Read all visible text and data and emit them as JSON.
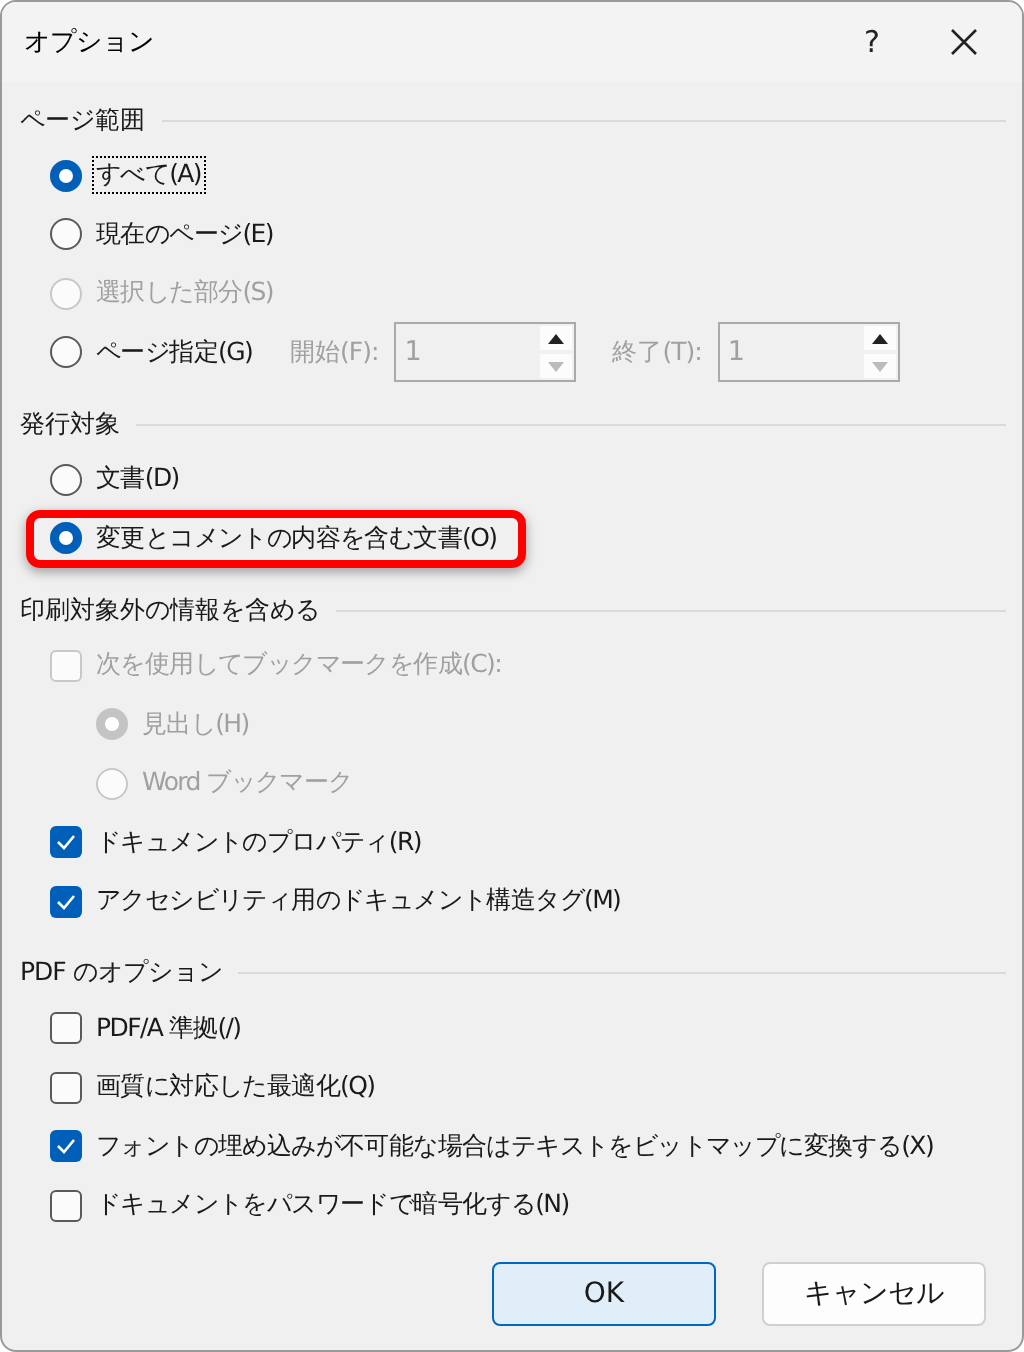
{
  "window": {
    "title": "オプション",
    "help": "?"
  },
  "sections": [
    {
      "title": "ページ範囲",
      "items": [
        {
          "kind": "radio",
          "label": "すべて(A)",
          "selected": true,
          "disabled": false,
          "focused": true
        },
        {
          "kind": "radio",
          "label": "現在のページ(E)",
          "selected": false,
          "disabled": false
        },
        {
          "kind": "radio",
          "label": "選択した部分(S)",
          "selected": false,
          "disabled": true
        },
        {
          "kind": "range",
          "label": "ページ指定(G)",
          "selected": false,
          "disabled": false,
          "fields": [
            {
              "label": "開始(F):",
              "value": "1"
            },
            {
              "label": "終了(T):",
              "value": "1"
            }
          ]
        }
      ]
    },
    {
      "title": "発行対象",
      "items": [
        {
          "kind": "radio",
          "label": "文書(D)",
          "selected": false,
          "disabled": false
        },
        {
          "kind": "radio",
          "label": "変更とコメントの内容を含む文書(O)",
          "selected": true,
          "disabled": false,
          "highlighted": true
        }
      ]
    },
    {
      "title": "印刷対象外の情報を含める",
      "items": [
        {
          "kind": "checkbox",
          "label": "次を使用してブックマークを作成(C):",
          "checked": false,
          "disabled": true,
          "children": [
            {
              "kind": "radio",
              "label": "見出し(H)",
              "selected": true,
              "disabled": true
            },
            {
              "kind": "radio",
              "label": "Word ブックマーク",
              "selected": false,
              "disabled": true
            }
          ]
        },
        {
          "kind": "checkbox",
          "label": "ドキュメントのプロパティ(R)",
          "checked": true,
          "disabled": false
        },
        {
          "kind": "checkbox",
          "label": "アクセシビリティ用のドキュメント構造タグ(M)",
          "checked": true,
          "disabled": false
        }
      ]
    },
    {
      "title": "PDF のオプション",
      "items": [
        {
          "kind": "checkbox",
          "label": "PDF/A 準拠(/)",
          "checked": false,
          "disabled": false
        },
        {
          "kind": "checkbox",
          "label": "画質に対応した最適化(Q)",
          "checked": false,
          "disabled": false
        },
        {
          "kind": "checkbox",
          "label": "フォントの埋め込みが不可能な場合はテキストをビットマップに変換する(X)",
          "checked": true,
          "disabled": false
        },
        {
          "kind": "checkbox",
          "label": "ドキュメントをパスワードで暗号化する(N)",
          "checked": false,
          "disabled": false
        }
      ]
    }
  ],
  "buttons": [
    {
      "label": "OK",
      "default": true
    },
    {
      "label": "キャンセル",
      "default": false
    }
  ]
}
